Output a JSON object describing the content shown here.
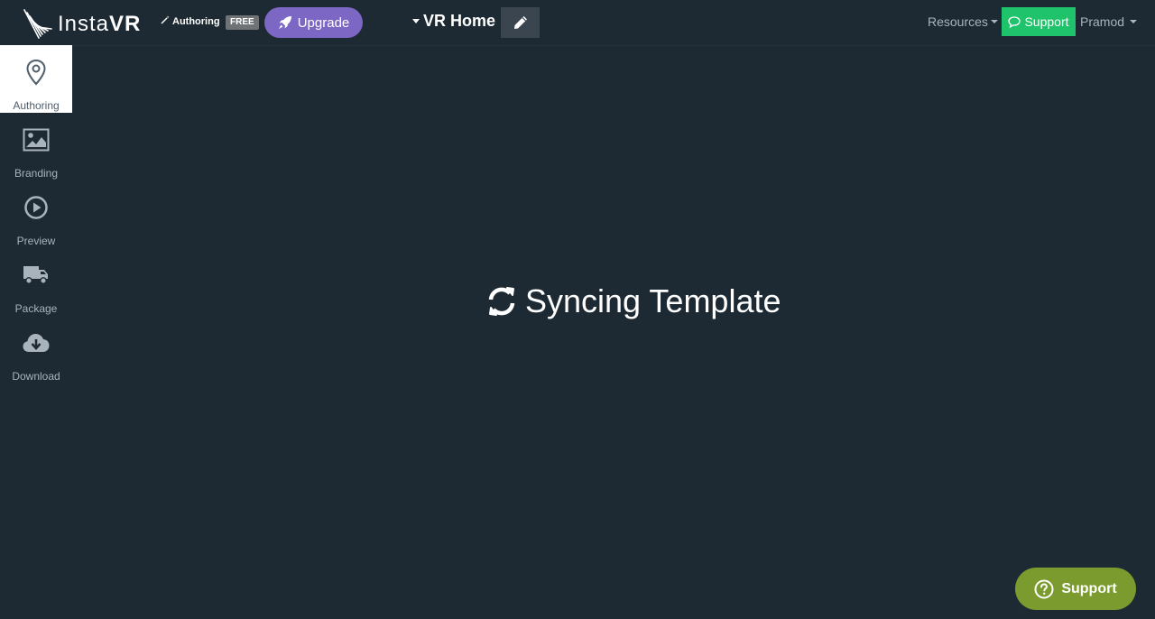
{
  "header": {
    "brand_insta": "Insta",
    "brand_vr": "VR",
    "mode_label": "Authoring",
    "plan_badge": "FREE",
    "upgrade_label": "Upgrade",
    "project_title": "VR Home",
    "resources_label": "Resources",
    "support_label": "Support",
    "user_name": "Pramod"
  },
  "sidebar": {
    "items": [
      {
        "label": "Authoring",
        "icon": "map-pin-icon",
        "active": true
      },
      {
        "label": "Branding",
        "icon": "image-icon",
        "active": false
      },
      {
        "label": "Preview",
        "icon": "play-circle-icon",
        "active": false
      },
      {
        "label": "Package",
        "icon": "truck-icon",
        "active": false
      },
      {
        "label": "Download",
        "icon": "cloud-download-icon",
        "active": false
      }
    ]
  },
  "main": {
    "status_text": "Syncing Template",
    "status_icon": "sync-icon"
  },
  "floating": {
    "support_label": "Support"
  },
  "colors": {
    "background": "#1d2a33",
    "upgrade": "#7c67c4",
    "support_green": "#1ec36b",
    "support_float": "#7c9b2e"
  }
}
